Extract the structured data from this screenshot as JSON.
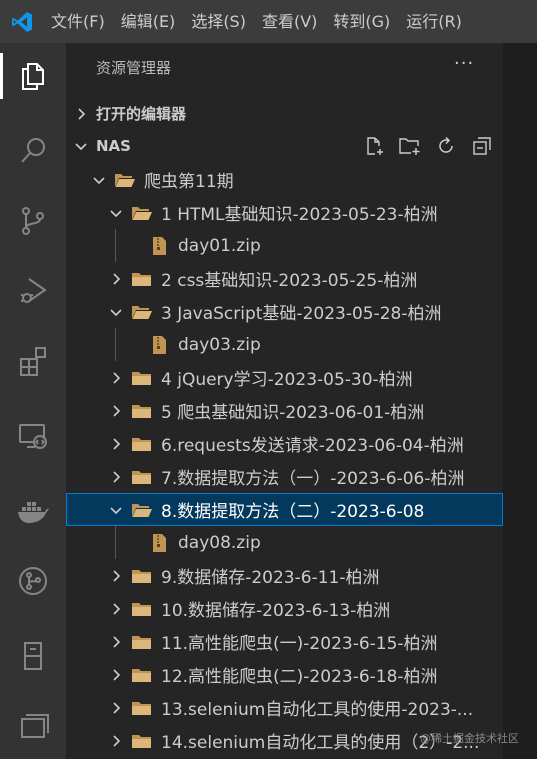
{
  "menubar": {
    "items": [
      "文件(F)",
      "编辑(E)",
      "选择(S)",
      "查看(V)",
      "转到(G)",
      "运行(R)"
    ]
  },
  "activitybar": {
    "icons": [
      "explorer-icon",
      "search-icon",
      "source-control-icon",
      "run-debug-icon",
      "extensions-icon",
      "remote-explorer-icon",
      "docker-icon",
      "gitlens-icon",
      "database-icon",
      "panels-icon"
    ]
  },
  "explorer": {
    "title": "资源管理器",
    "more": "···",
    "open_editors": "打开的编辑器",
    "workspace": "NAS"
  },
  "tree": [
    {
      "label": "爬虫第11期",
      "type": "folder",
      "expanded": true
    },
    {
      "label": "1 HTML基础知识-2023-05-23-柏洲",
      "type": "folder",
      "expanded": true
    },
    {
      "label": "day01.zip",
      "type": "zip"
    },
    {
      "label": "2 css基础知识-2023-05-25-柏洲",
      "type": "folder",
      "expanded": false
    },
    {
      "label": "3 JavaScript基础-2023-05-28-柏洲",
      "type": "folder",
      "expanded": true
    },
    {
      "label": "day03.zip",
      "type": "zip"
    },
    {
      "label": "4 jQuery学习-2023-05-30-柏洲",
      "type": "folder",
      "expanded": false
    },
    {
      "label": "5 爬虫基础知识-2023-06-01-柏洲",
      "type": "folder",
      "expanded": false
    },
    {
      "label": "6.requests发送请求-2023-06-04-柏洲",
      "type": "folder",
      "expanded": false
    },
    {
      "label": "7.数据提取方法（一）-2023-6-06-柏洲",
      "type": "folder",
      "expanded": false
    },
    {
      "label": "8.数据提取方法（二）-2023-6-08",
      "type": "folder",
      "expanded": true,
      "selected": true
    },
    {
      "label": "day08.zip",
      "type": "zip"
    },
    {
      "label": "9.数据储存-2023-6-11-柏洲",
      "type": "folder",
      "expanded": false
    },
    {
      "label": "10.数据储存-2023-6-13-柏洲",
      "type": "folder",
      "expanded": false
    },
    {
      "label": "11.高性能爬虫(一)-2023-6-15-柏洲",
      "type": "folder",
      "expanded": false
    },
    {
      "label": "12.高性能爬虫(二)-2023-6-18-柏洲",
      "type": "folder",
      "expanded": false
    },
    {
      "label": "13.selenium自动化工具的使用-2023-...",
      "type": "folder",
      "expanded": false
    },
    {
      "label": "14.selenium自动化工具的使用（2）-2...",
      "type": "folder",
      "expanded": false
    }
  ],
  "watermark": "@稀土掘金技术社区",
  "colors": {
    "menubar": "#3c3c3c",
    "activitybar": "#333333",
    "sidebar": "#252526",
    "selection": "#04395e",
    "selection_border": "#007fd4",
    "folder": "#c09553"
  }
}
